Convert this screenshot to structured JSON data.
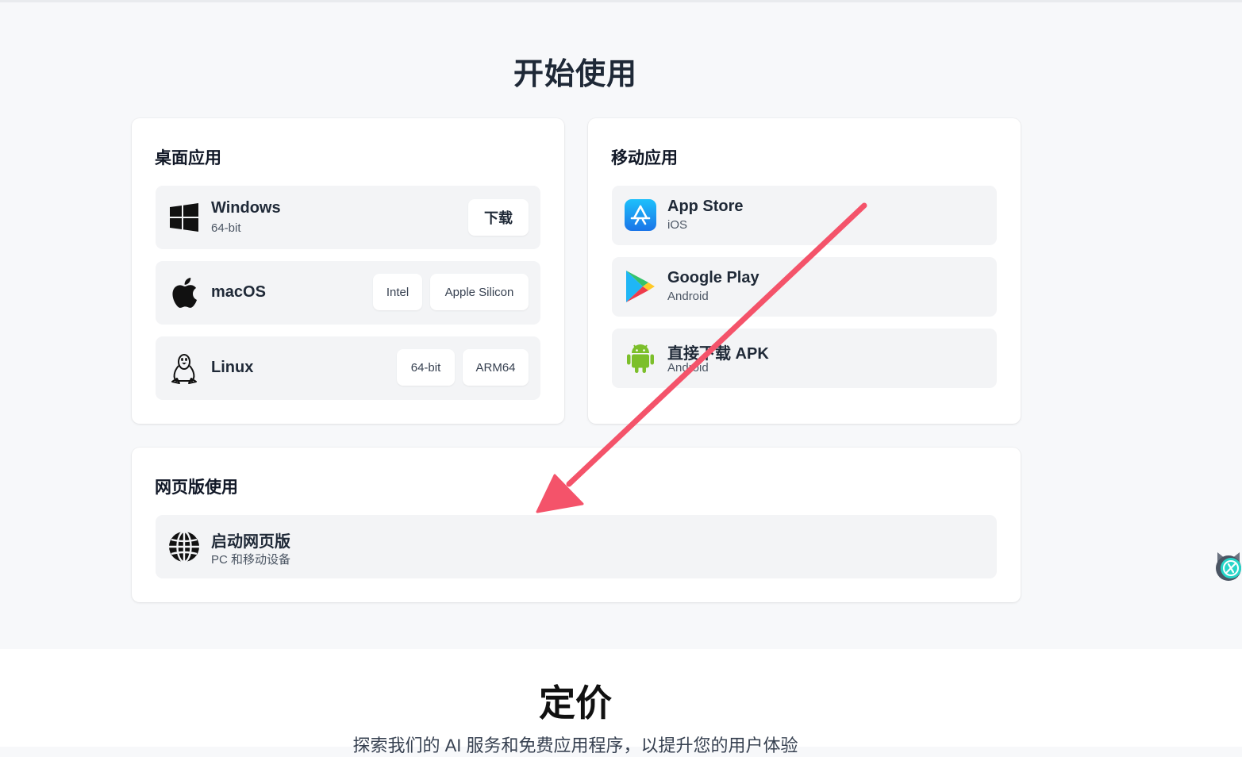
{
  "hero": {
    "title": "开始使用"
  },
  "desktop": {
    "title": "桌面应用",
    "windows": {
      "name": "Windows",
      "sub": "64-bit",
      "download_label": "下载"
    },
    "macos": {
      "name": "macOS",
      "intel_label": "Intel",
      "apple_silicon_label": "Apple Silicon"
    },
    "linux": {
      "name": "Linux",
      "x64_label": "64-bit",
      "arm64_label": "ARM64"
    }
  },
  "mobile": {
    "title": "移动应用",
    "appstore": {
      "name": "App Store",
      "sub": "iOS"
    },
    "googleplay": {
      "name": "Google Play",
      "sub": "Android"
    },
    "apk": {
      "name": "直接下载 APK",
      "sub": "Android"
    }
  },
  "web": {
    "title": "网页版使用",
    "launch": {
      "name": "启动网页版",
      "sub": "PC 和移动设备"
    }
  },
  "pricing": {
    "title": "定价",
    "subtitle": "探索我们的 AI 服务和免费应用程序，以提升您的用户体验"
  },
  "icons": {
    "windows": "windows-icon",
    "apple": "apple-icon",
    "linux": "linux-tux-icon",
    "appstore": "app-store-icon",
    "googleplay": "google-play-icon",
    "android": "android-icon",
    "globe": "globe-icon"
  },
  "colors": {
    "annotation_arrow": "#f4536a",
    "row_bg": "#f3f4f6",
    "page_bg": "#f7f8fa"
  }
}
